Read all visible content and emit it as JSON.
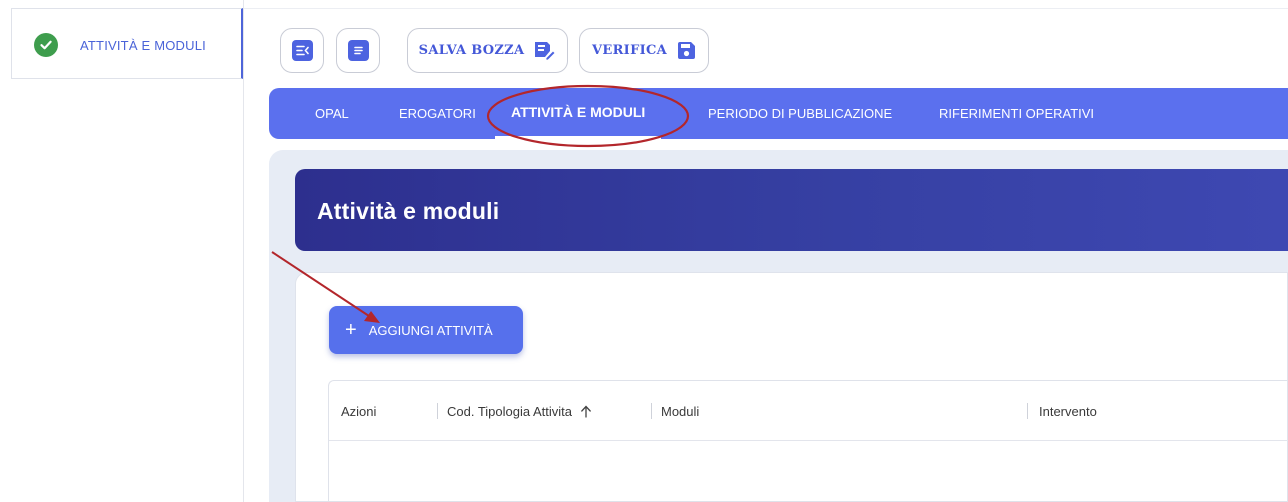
{
  "sidebar": {
    "items": [
      {
        "label": "ATTIVITÀ E MODULI",
        "icon": "check-circle-icon",
        "status_color": "#3e9d4d"
      }
    ]
  },
  "toolbar": {
    "collapse_icon": "collapse-menu-icon",
    "document_icon": "document-icon",
    "save_draft_label": "SALVA BOZZA",
    "save_draft_icon": "edit-document-icon",
    "verify_label": "VERIFICA",
    "verify_icon": "floppy-disk-icon"
  },
  "tabs": [
    {
      "label": "OPAL",
      "active": false
    },
    {
      "label": "EROGATORI",
      "active": false
    },
    {
      "label": "ATTIVITÀ E MODULI",
      "active": true
    },
    {
      "label": "PERIODO DI PUBBLICAZIONE",
      "active": false
    },
    {
      "label": "RIFERIMENTI OPERATIVI",
      "active": false
    }
  ],
  "section": {
    "title": "Attività e moduli",
    "add_button_label": "AGGIUNGI ATTIVITÀ"
  },
  "table": {
    "columns": [
      "Azioni",
      "Cod. Tipologia Attivita",
      "Moduli",
      "Intervento"
    ],
    "sort_icon": "arrow-up-icon",
    "rows": []
  },
  "colors": {
    "accent": "#5b70ee",
    "header_dark": "#2d2f8e",
    "annotation": "#b3262b"
  }
}
